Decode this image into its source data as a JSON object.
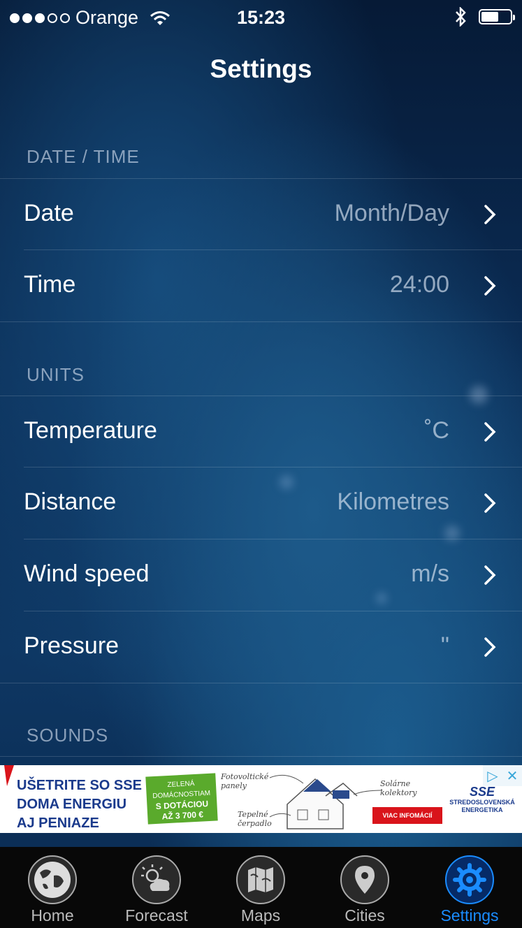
{
  "status_bar": {
    "carrier": "Orange",
    "signal_bars_filled": 3,
    "signal_bars_total": 5,
    "time": "15:23",
    "battery_level": 0.55,
    "icons": [
      "wifi-icon",
      "bluetooth-icon",
      "battery-icon"
    ]
  },
  "nav": {
    "title": "Settings"
  },
  "sections": {
    "date_time": {
      "header": "DATE / TIME",
      "rows": [
        {
          "label": "Date",
          "value": "Month/Day"
        },
        {
          "label": "Time",
          "value": "24:00"
        }
      ]
    },
    "units": {
      "header": "UNITS",
      "rows": [
        {
          "label": "Temperature",
          "value": "˚C"
        },
        {
          "label": "Distance",
          "value": "Kilometres"
        },
        {
          "label": "Wind speed",
          "value": "m/s"
        },
        {
          "label": "Pressure",
          "value": "\""
        }
      ]
    },
    "sounds": {
      "header": "SOUNDS"
    }
  },
  "ad": {
    "headline_1": "UŠETRITE SO SSE",
    "headline_2": "DOMA ENERGIU",
    "headline_3": "AJ PENIAZE",
    "green_1": "ZELENÁ",
    "green_2": "DOMÁCNOSTIAM",
    "green_3": "S DOTÁCIOU",
    "green_4": "AŽ 3 700 €",
    "sketch_1": "Fotovoltické panely",
    "sketch_2": "Solárne kolektory",
    "sketch_3": "Tepelné čerpadlo",
    "button": "VIAC INFOMÁCIÍ",
    "logo_1": "SSE",
    "logo_2": "STREDOSLOVENSKÁ",
    "logo_3": "ENERGETIKA"
  },
  "tabbar": {
    "tabs": [
      {
        "label": "Home",
        "icon": "globe-icon",
        "active": false
      },
      {
        "label": "Forecast",
        "icon": "sun-cloud-icon",
        "active": false
      },
      {
        "label": "Maps",
        "icon": "map-icon",
        "active": false
      },
      {
        "label": "Cities",
        "icon": "location-pin-icon",
        "active": false
      },
      {
        "label": "Settings",
        "icon": "gear-icon",
        "active": true
      }
    ]
  },
  "colors": {
    "accent": "#1a8cff",
    "ad_red": "#d9141b",
    "ad_green": "#5aaa2c"
  }
}
